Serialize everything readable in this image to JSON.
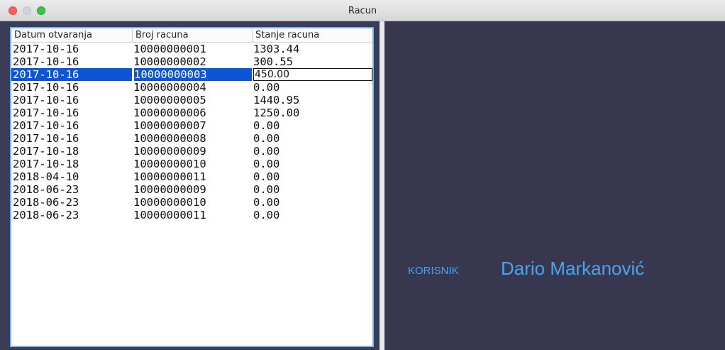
{
  "window": {
    "title": "Racun"
  },
  "table": {
    "headers": [
      "Datum otvaranja",
      "Broj racuna",
      "Stanje racuna"
    ],
    "selected_index": 2,
    "rows": [
      [
        "2017-10-16",
        "10000000001",
        "1303.44"
      ],
      [
        "2017-10-16",
        "10000000002",
        "300.55"
      ],
      [
        "2017-10-16",
        "10000000003",
        "450.00"
      ],
      [
        "2017-10-16",
        "10000000004",
        "0.00"
      ],
      [
        "2017-10-16",
        "10000000005",
        "1440.95"
      ],
      [
        "2017-10-16",
        "10000000006",
        "1250.00"
      ],
      [
        "2017-10-16",
        "10000000007",
        "0.00"
      ],
      [
        "2017-10-16",
        "10000000008",
        "0.00"
      ],
      [
        "2017-10-18",
        "10000000009",
        "0.00"
      ],
      [
        "2017-10-18",
        "10000000010",
        "0.00"
      ],
      [
        "2018-04-10",
        "10000000011",
        "0.00"
      ],
      [
        "2018-06-23",
        "10000000009",
        "0.00"
      ],
      [
        "2018-06-23",
        "10000000010",
        "0.00"
      ],
      [
        "2018-06-23",
        "10000000011",
        "0.00"
      ]
    ]
  },
  "user": {
    "label": "KORISNIK",
    "name": "Dario Markanović"
  },
  "colors": {
    "accent": "#4aa3ef",
    "panel": "#373850",
    "selection": "#0b55d6"
  }
}
